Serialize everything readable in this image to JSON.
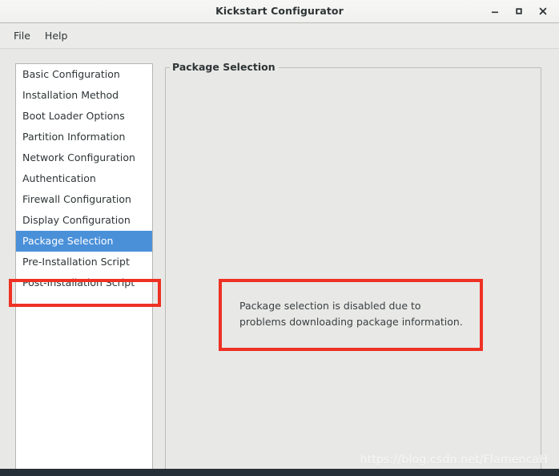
{
  "window": {
    "title": "Kickstart Configurator",
    "controls": [
      {
        "name": "minimize",
        "glyph": "–"
      },
      {
        "name": "maximize",
        "glyph": "□"
      },
      {
        "name": "close",
        "glyph": "✕"
      }
    ]
  },
  "menubar": {
    "items": [
      {
        "label": "File"
      },
      {
        "label": "Help"
      }
    ]
  },
  "sidebar": {
    "items": [
      {
        "label": "Basic Configuration",
        "selected": false
      },
      {
        "label": "Installation Method",
        "selected": false
      },
      {
        "label": "Boot Loader Options",
        "selected": false
      },
      {
        "label": "Partition Information",
        "selected": false
      },
      {
        "label": "Network Configuration",
        "selected": false
      },
      {
        "label": "Authentication",
        "selected": false
      },
      {
        "label": "Firewall Configuration",
        "selected": false
      },
      {
        "label": "Display Configuration",
        "selected": false
      },
      {
        "label": "Package Selection",
        "selected": true
      },
      {
        "label": "Pre-Installation Script",
        "selected": false
      },
      {
        "label": "Post-Installation Script",
        "selected": false
      }
    ]
  },
  "panel": {
    "frame_label": "Package Selection",
    "message_line1": "Package selection is disabled due to",
    "message_line2": "problems downloading package information."
  },
  "annotations": {
    "color": "#ee3124",
    "sidebar_highlight": "Package Selection",
    "message_highlight": "Package selection is disabled due to problems downloading package information."
  },
  "watermark": {
    "text": "https://blog.csdn.net/FlamencaH"
  },
  "colors": {
    "selection_blue": "#4a90d9",
    "annotation_red": "#ee3124",
    "window_background": "#e8e8e6",
    "titlebar": "#f5f5f3",
    "menubar": "#ebebe9",
    "list_background": "#ffffff",
    "text": "#2e3436"
  }
}
